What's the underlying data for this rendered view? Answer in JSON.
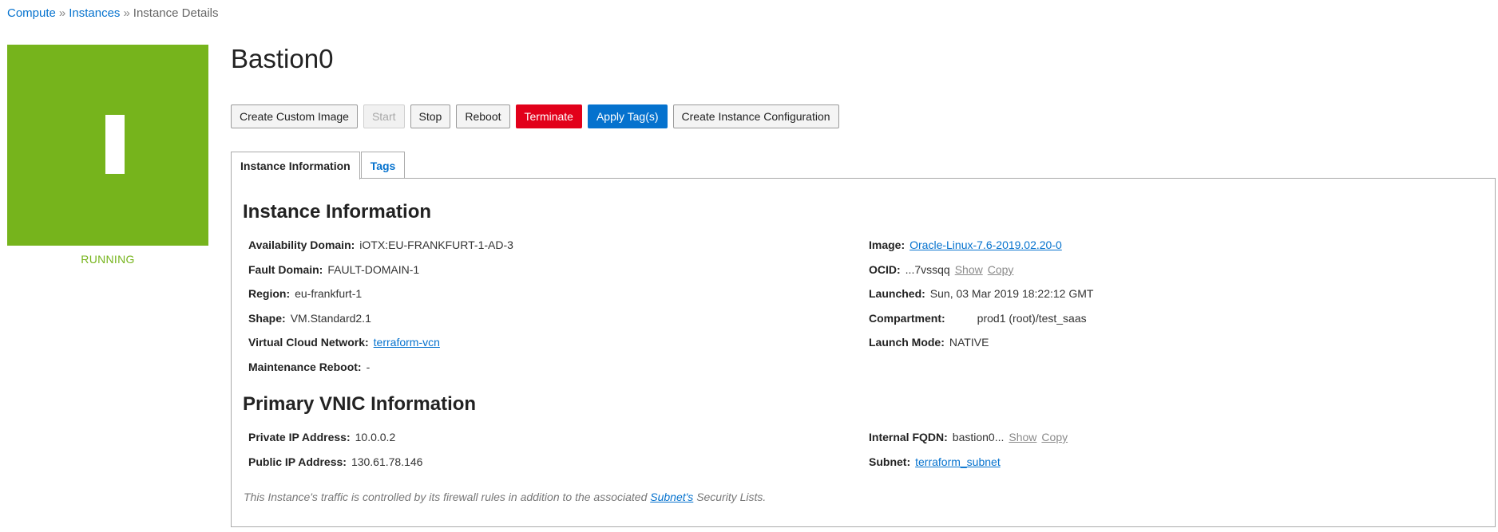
{
  "breadcrumb": {
    "compute": "Compute",
    "separator1": "»",
    "instances": "Instances",
    "separator2": "»",
    "current": "Instance Details"
  },
  "instance": {
    "icon_letter": "I",
    "status": "RUNNING",
    "name": "Bastion0",
    "tile_color": "#76b41c"
  },
  "actions": {
    "create_custom_image": "Create Custom Image",
    "start": "Start",
    "stop": "Stop",
    "reboot": "Reboot",
    "terminate": "Terminate",
    "apply_tags": "Apply Tag(s)",
    "create_instance_config": "Create Instance Configuration"
  },
  "tabs": {
    "instance_information": "Instance Information",
    "tags": "Tags"
  },
  "instance_info": {
    "heading": "Instance Information",
    "availability_domain": {
      "label": "Availability Domain:",
      "value": "iOTX:EU-FRANKFURT-1-AD-3"
    },
    "fault_domain": {
      "label": "Fault Domain:",
      "value": "FAULT-DOMAIN-1"
    },
    "region": {
      "label": "Region:",
      "value": "eu-frankfurt-1"
    },
    "shape": {
      "label": "Shape:",
      "value": "VM.Standard2.1"
    },
    "vcn": {
      "label": "Virtual Cloud Network:",
      "value": "terraform-vcn"
    },
    "maintenance_reboot": {
      "label": "Maintenance Reboot:",
      "value": "-"
    },
    "image": {
      "label": "Image:",
      "value": "Oracle-Linux-7.6-2019.02.20-0"
    },
    "ocid": {
      "label": "OCID:",
      "value": "...7vssqq",
      "show": "Show",
      "copy": "Copy"
    },
    "launched": {
      "label": "Launched:",
      "value": "Sun, 03 Mar 2019 18:22:12 GMT"
    },
    "compartment": {
      "label": "Compartment:",
      "value": "prod1 (root)/test_saas"
    },
    "launch_mode": {
      "label": "Launch Mode:",
      "value": "NATIVE"
    }
  },
  "vnic_info": {
    "heading": "Primary VNIC Information",
    "private_ip": {
      "label": "Private IP Address:",
      "value": "10.0.0.2"
    },
    "public_ip": {
      "label": "Public IP Address:",
      "value": "130.61.78.146"
    },
    "internal_fqdn": {
      "label": "Internal FQDN:",
      "value": "bastion0...",
      "show": "Show",
      "copy": "Copy"
    },
    "subnet": {
      "label": "Subnet:",
      "value": "terraform_subnet"
    }
  },
  "note": {
    "prefix": "This Instance's traffic is controlled by its firewall rules in addition to the associated",
    "link": "Subnet's",
    "suffix": "Security Lists."
  }
}
